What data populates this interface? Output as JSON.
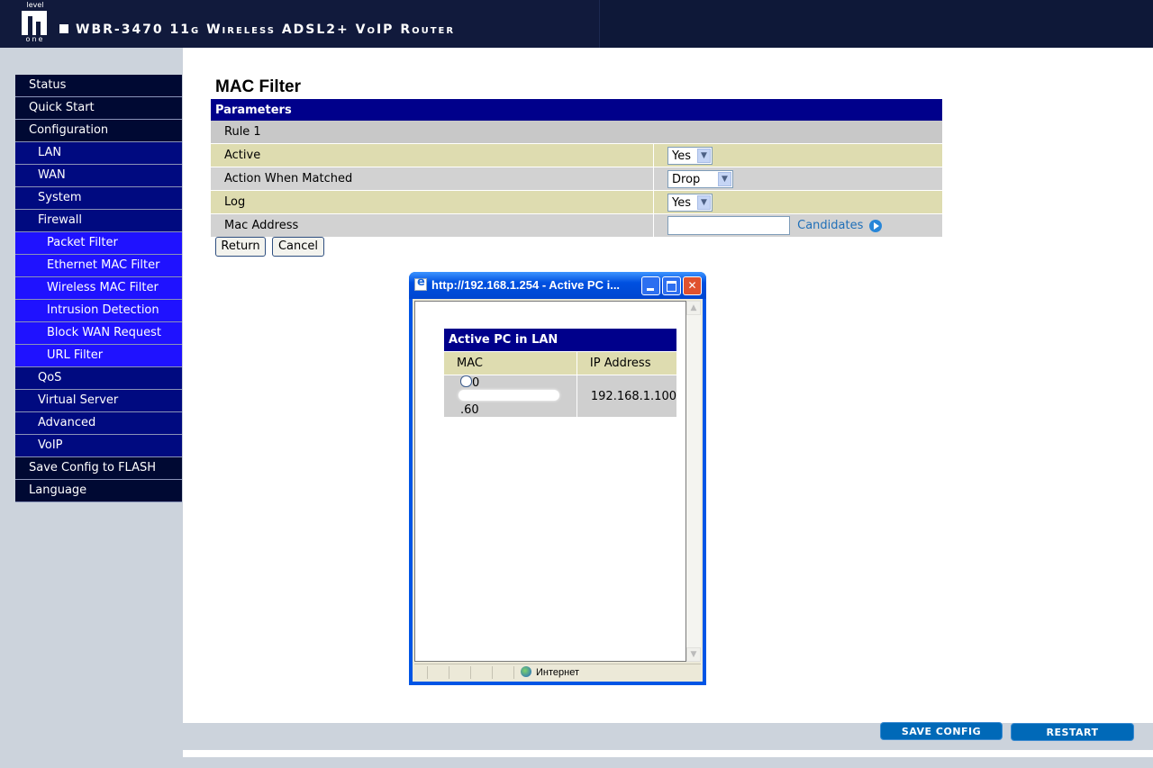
{
  "header": {
    "logo_top": "level",
    "logo_bottom": "one",
    "product_title": "WBR-3470 11g Wireless ADSL2+ VoIP Router"
  },
  "sidebar": {
    "items": [
      {
        "label": "Status",
        "level": 1
      },
      {
        "label": "Quick Start",
        "level": 1
      },
      {
        "label": "Configuration",
        "level": 1
      },
      {
        "label": "LAN",
        "level": 2
      },
      {
        "label": "WAN",
        "level": 2
      },
      {
        "label": "System",
        "level": 2
      },
      {
        "label": "Firewall",
        "level": 2
      },
      {
        "label": "Packet Filter",
        "level": 3
      },
      {
        "label": "Ethernet MAC Filter",
        "level": 3
      },
      {
        "label": "Wireless MAC Filter",
        "level": 3
      },
      {
        "label": "Intrusion Detection",
        "level": 3
      },
      {
        "label": "Block WAN Request",
        "level": 3
      },
      {
        "label": "URL Filter",
        "level": 3
      },
      {
        "label": "QoS",
        "level": 2
      },
      {
        "label": "Virtual Server",
        "level": 2
      },
      {
        "label": "Advanced",
        "level": 2
      },
      {
        "label": "VoIP",
        "level": 2
      },
      {
        "label": "Save Config to FLASH",
        "level": 1
      },
      {
        "label": "Language",
        "level": 1
      }
    ]
  },
  "main": {
    "title": "MAC Filter",
    "section_header": "Parameters",
    "rule_label": "Rule 1",
    "fields": {
      "active": {
        "label": "Active",
        "value": "Yes"
      },
      "action": {
        "label": "Action When Matched",
        "value": "Drop"
      },
      "log": {
        "label": "Log",
        "value": "Yes"
      },
      "mac": {
        "label": "Mac Address",
        "value": ""
      }
    },
    "candidates_link": "Candidates",
    "return_button": "Return",
    "cancel_button": "Cancel"
  },
  "popup": {
    "title": "http://192.168.1.254 - Active PC i...",
    "table_title": "Active PC in LAN",
    "col_mac": "MAC",
    "col_ip": "IP Address",
    "rows": [
      {
        "mac_prefix": "0",
        "mac_suffix": ".60",
        "ip": "192.168.1.100"
      }
    ],
    "status_zone": "Интернет"
  },
  "footer": {
    "save_config": "SAVE CONFIG",
    "restart": "RESTART"
  },
  "colors": {
    "header_bg": "#111a3c",
    "nav_level1": "#000933",
    "nav_level2": "#000a80",
    "nav_level3": "#1f12ff",
    "table_header": "#00008b",
    "row_tan": "#dedcb0",
    "row_gray": "#d2d2d2",
    "action_button": "#0069b8"
  }
}
